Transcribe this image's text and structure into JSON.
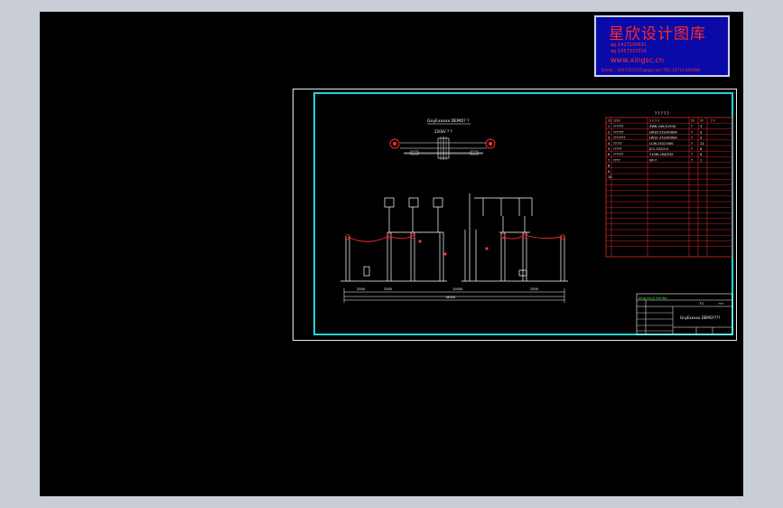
{
  "watermark": {
    "title": "星欣设计图库",
    "qq1": "qq:1417200931",
    "qq2": "qq:1057315315",
    "url": "www.xingsc.cn",
    "footer": "Email : 1057315315@qq.com  TEL:13711342000"
  },
  "drawing": {
    "section_title": "GnyExxxxx DEMO? ?",
    "plan_label": "220kV ? ?",
    "dim_left": "2500",
    "dim_left2": "2500",
    "dim_center": "10000",
    "dim_right": "2500",
    "dim_total": "18000"
  },
  "bom": {
    "caption": "? ? ? ? ?",
    "header": [
      "??",
      "????",
      "? ? ? ?",
      "??",
      "??",
      "? ?"
    ],
    "rows": [
      [
        "1",
        "??????",
        "ZW6-245/3150A",
        "?",
        "3",
        ""
      ],
      [
        "2",
        "??????",
        "LW30-252/4000A",
        "?",
        "3",
        ""
      ],
      [
        "3",
        "???????",
        "LW31-252/4000A",
        "?",
        "3",
        ""
      ],
      [
        "4",
        "?????",
        "LCW-252/1000",
        "?",
        "12",
        ""
      ],
      [
        "5",
        "?????",
        "JCC-252/0.5",
        "?",
        "6",
        ""
      ],
      [
        "6",
        "??????",
        "Y10W-204/532",
        "?",
        "6",
        ""
      ],
      [
        "7",
        "????",
        "XP-7",
        "?",
        "1",
        ""
      ],
      [
        "8",
        "",
        "",
        "",
        "",
        ""
      ],
      [
        "9",
        "",
        "",
        "",
        "",
        ""
      ],
      [
        "10",
        "",
        "",
        "",
        "",
        ""
      ]
    ]
  },
  "title_block": {
    "company": "Xing Xin Ji Xie Wu",
    "drawing_name": "GnyExxxxx DEMO????",
    "sheet": "F1",
    "scale": "????"
  }
}
